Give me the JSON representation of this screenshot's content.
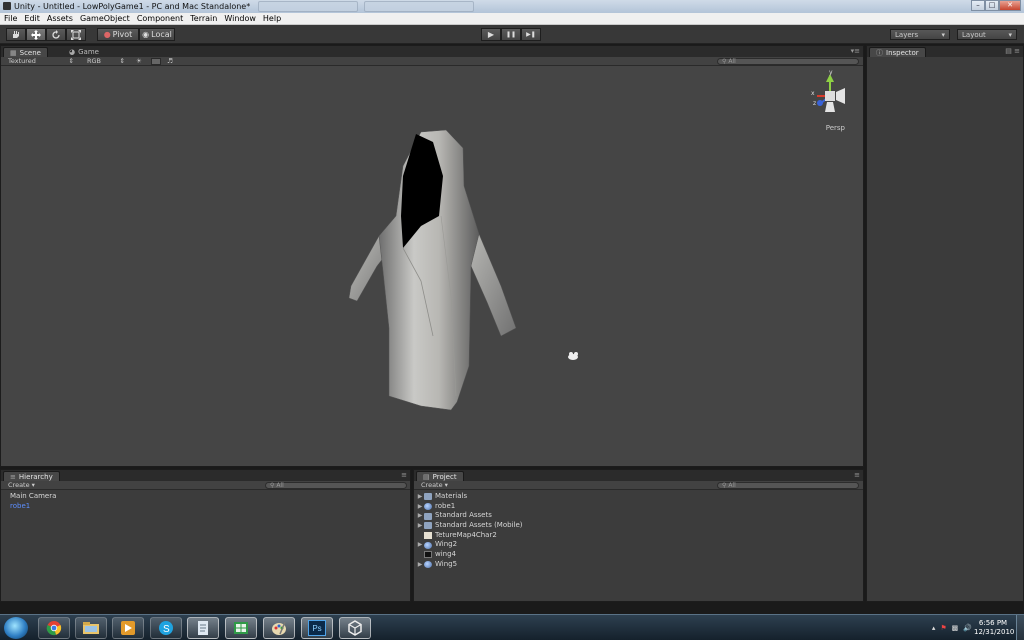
{
  "window": {
    "title": "Unity - Untitled - LowPolyGame1 - PC and Mac Standalone*",
    "minimize": "–",
    "maximize": "□",
    "close": "✕"
  },
  "menu": [
    "File",
    "Edit",
    "Assets",
    "GameObject",
    "Component",
    "Terrain",
    "Window",
    "Help"
  ],
  "toolbar": {
    "pivot_label": "Pivot",
    "local_label": "Local",
    "play_icon": "▶",
    "pause_icon": "❚❚",
    "step_icon": "▶❚",
    "layers_label": "Layers",
    "layout_label": "Layout"
  },
  "scene_panel": {
    "tab_scene": "Scene",
    "tab_game": "Game",
    "draw_mode": "Textured",
    "render_mode": "RGB",
    "search_placeholder": "All",
    "persp_label": "Persp",
    "gizmo_axes": {
      "y": "y",
      "x": "x",
      "z": "z"
    }
  },
  "inspector_panel": {
    "tab": "Inspector"
  },
  "hierarchy_panel": {
    "tab": "Hierarchy",
    "create_label": "Create ▾",
    "search_placeholder": "All",
    "items": [
      {
        "label": "Main Camera",
        "selected": false
      },
      {
        "label": "robe1",
        "selected": true
      }
    ]
  },
  "project_panel": {
    "tab": "Project",
    "create_label": "Create ▾",
    "search_placeholder": "All",
    "items": [
      {
        "label": "Materials",
        "icon": "folder-icon",
        "expandable": true
      },
      {
        "label": "robe1",
        "icon": "prefab-icon",
        "expandable": true
      },
      {
        "label": "Standard Assets",
        "icon": "folder-icon",
        "expandable": true
      },
      {
        "label": "Standard Assets (Mobile)",
        "icon": "folder-icon",
        "expandable": true
      },
      {
        "label": "TetureMap4Char2",
        "icon": "texture-icon",
        "expandable": false
      },
      {
        "label": "Wing2",
        "icon": "prefab-icon",
        "expandable": true
      },
      {
        "label": "wing4",
        "icon": "wing-icon",
        "expandable": false
      },
      {
        "label": "Wing5",
        "icon": "prefab-icon",
        "expandable": true
      }
    ]
  },
  "taskbar": {
    "apps": [
      "chrome-icon",
      "explorer-icon",
      "media-player-icon",
      "skype-icon",
      "notepad-icon",
      "spreadsheet-icon",
      "paint-icon",
      "photoshop-icon",
      "unity-icon"
    ],
    "photoshop_label": "Ps",
    "time": "6:56 PM",
    "date": "12/31/2010"
  },
  "colors": {
    "selection_blue": "#5d8fff",
    "panel_bg": "#3b3b3b",
    "viewport_bg": "#454545"
  }
}
